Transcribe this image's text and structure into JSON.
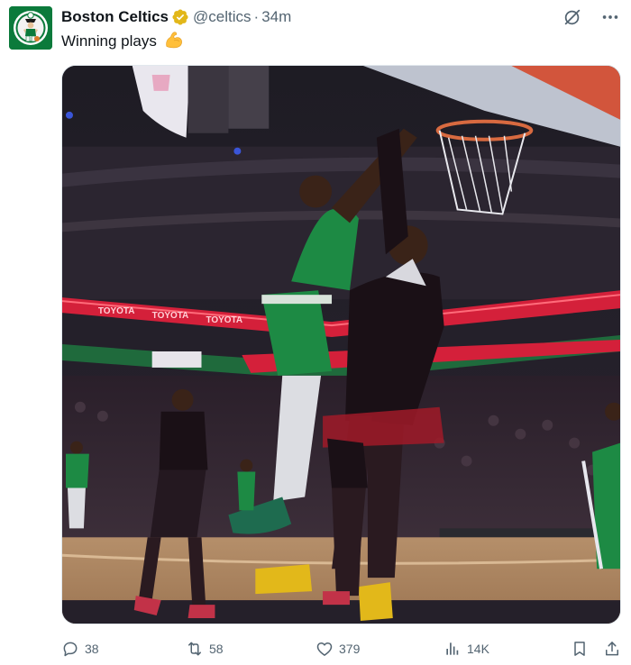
{
  "tweet": {
    "author_name": "Boston Celtics",
    "handle": "@celtics",
    "separator": "·",
    "timestamp": "34m",
    "text": "Winning plays",
    "emoji": "flexed-biceps",
    "verified": true,
    "avatar": "celtics-logo",
    "brand_color": "#0b7a3b"
  },
  "media": {
    "type": "video-still",
    "arena_signage": [
      "TOYOTA",
      "TOYOTA",
      "TOYOTA"
    ]
  },
  "actions": {
    "reply_count": "38",
    "retweet_count": "58",
    "like_count": "379",
    "view_count": "14K"
  },
  "icons": {
    "more": "more-icon",
    "grok": "grok-icon",
    "reply": "reply-icon",
    "retweet": "retweet-icon",
    "like": "like-icon",
    "views": "views-icon",
    "bookmark": "bookmark-icon",
    "share": "share-icon"
  },
  "colors": {
    "text": "#0f1419",
    "muted": "#536471",
    "verified_gold": "#e2b719"
  }
}
